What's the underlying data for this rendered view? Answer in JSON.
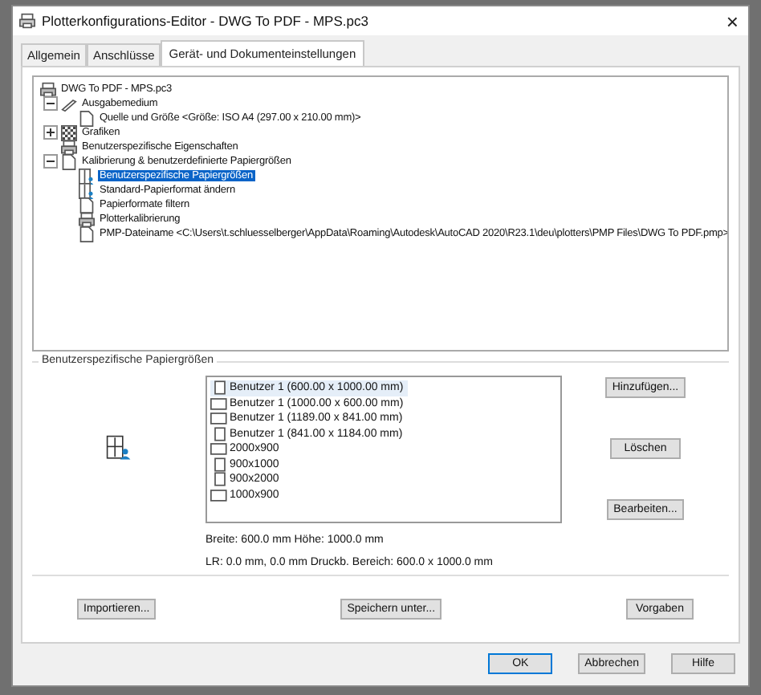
{
  "window": {
    "title": "Plotterkonfigurations-Editor - DWG To PDF - MPS.pc3",
    "close": "×"
  },
  "tabs": [
    {
      "label": "Allgemein",
      "selected": false
    },
    {
      "label": "Anschlüsse",
      "selected": false
    },
    {
      "label": "Gerät- und Dokumenteinstellungen",
      "selected": true
    }
  ],
  "tree": {
    "label": "DWG To PDF - MPS.pc3",
    "kind": "printer",
    "selected": false,
    "children": [
      {
        "label": "Ausgabemedium",
        "kind": "pen",
        "selected": false,
        "expanded": true,
        "children": [
          {
            "label": "Quelle und Größe <Größe: ISO A4 (297.00 x 210.00 mm)>",
            "kind": "paper",
            "selected": false
          }
        ]
      },
      {
        "label": "Grafiken",
        "kind": "grid",
        "selected": false,
        "expanded": false
      },
      {
        "label": "Benutzerspezifische Eigenschaften",
        "kind": "printer",
        "selected": false
      },
      {
        "label": "Kalibrierung & benutzerdefinierte Papiergrößen",
        "kind": "paper",
        "selected": false,
        "expanded": true,
        "children": [
          {
            "label": "Benutzerspezifische Papiergrößen",
            "kind": "custom",
            "selected": true
          },
          {
            "label": "Standard-Papierformat ändern",
            "kind": "custom",
            "selected": false
          },
          {
            "label": "Papierformate filtern",
            "kind": "blank",
            "selected": false
          },
          {
            "label": "Plotterkalibrierung",
            "kind": "printer",
            "selected": false
          },
          {
            "label": "PMP-Dateiname <C:\\Users\\t.schluesselberger\\AppData\\Roaming\\Autodesk\\AutoCAD 2020\\R23.1\\deu\\plotters\\PMP Files\\DWG To PDF.pmp>",
            "kind": "paper",
            "selected": false
          }
        ]
      }
    ]
  },
  "group": {
    "title": "Benutzerspezifische Papiergrößen",
    "papers": [
      {
        "label": "Benutzer 1 (600.00 x 1000.00 mm)",
        "kind": "portrait",
        "selected": true
      },
      {
        "label": "Benutzer 1 (1000.00 x 600.00 mm)",
        "kind": "landscape",
        "selected": false
      },
      {
        "label": "Benutzer 1 (1189.00 x 841.00 mm)",
        "kind": "landscape",
        "selected": false
      },
      {
        "label": "Benutzer 1 (841.00 x 1184.00 mm)",
        "kind": "portrait",
        "selected": false
      },
      {
        "label": "2000x900",
        "kind": "landscape",
        "selected": false
      },
      {
        "label": "900x1000",
        "kind": "portrait",
        "selected": false
      },
      {
        "label": "900x2000",
        "kind": "portrait",
        "selected": false
      },
      {
        "label": "1000x900",
        "kind": "landscape",
        "selected": false
      }
    ],
    "side_buttons": [
      "Hinzufügen...",
      "Löschen",
      "Bearbeiten..."
    ],
    "info": [
      "Breite: 600.0 mm Höhe: 1000.0 mm",
      "LR: 0.0 mm, 0.0 mm  Druckb. Bereich: 600.0 x 1000.0 mm"
    ]
  },
  "panel_buttons": [
    "Importieren...",
    "Speichern unter...",
    "Vorgaben"
  ],
  "dialog_buttons": [
    {
      "label": "OK",
      "default": true
    },
    {
      "label": "Abbrechen",
      "default": false
    },
    {
      "label": "Hilfe",
      "default": false
    }
  ]
}
